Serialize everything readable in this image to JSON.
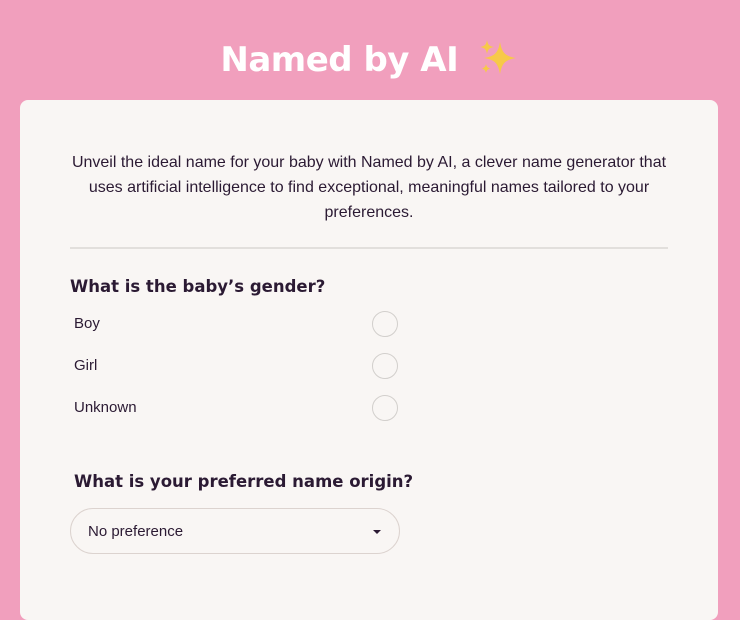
{
  "header": {
    "title": "Named by AI",
    "title_icon": "sparkles-icon"
  },
  "intro": {
    "text": "Unveil the ideal name for your baby with Named by AI, a clever name generator that uses artificial intelligence to find exceptional, meaningful names tailored to your preferences."
  },
  "gender": {
    "question": "What is the baby’s gender?",
    "options": [
      {
        "label": "Boy"
      },
      {
        "label": "Girl"
      },
      {
        "label": "Unknown"
      }
    ]
  },
  "origin": {
    "question": "What is your preferred name origin?",
    "selected": "No preference"
  },
  "colors": {
    "background": "#f19fbd",
    "card": "#f9f6f4",
    "text": "#2b1a33",
    "sparkle": "#f7c948"
  }
}
